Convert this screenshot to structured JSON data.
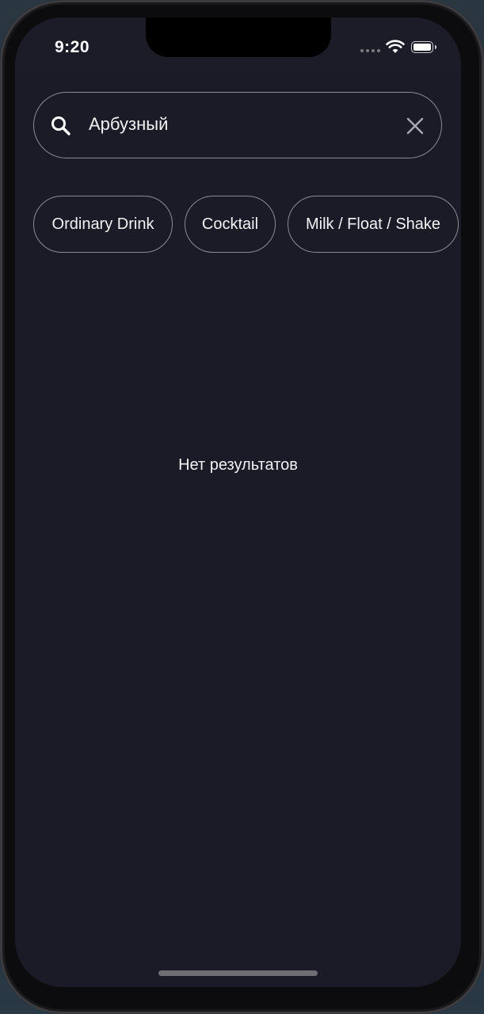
{
  "status_bar": {
    "time": "9:20",
    "icons": [
      "cellular-signal-icon",
      "wifi-icon",
      "battery-icon"
    ]
  },
  "search": {
    "value": "Арбузный",
    "leading_icon": "search-icon",
    "trailing_icon": "close-icon"
  },
  "filters": [
    {
      "label": "Ordinary Drink"
    },
    {
      "label": "Cocktail"
    },
    {
      "label": "Milk / Float / Shake"
    }
  ],
  "results": {
    "empty_message": "Нет результатов"
  },
  "colors": {
    "background": "#1b1a27",
    "text": "#f2f2f5",
    "outline": "#8c8b96"
  }
}
